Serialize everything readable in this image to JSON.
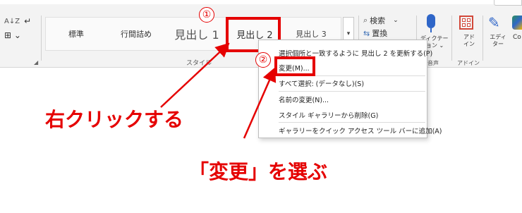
{
  "ribbon": {
    "paragraph_tools": {
      "sort_label": "A↓Z",
      "return_label": "↵",
      "border_label": "⊞ ⌄"
    },
    "styles_group_label": "スタイル",
    "voice_group_label": "音声",
    "addins_group_label": "アドイン"
  },
  "style_gallery": {
    "items": [
      "標準",
      "行間詰め",
      "見出し 1",
      "見出し 2",
      "見出し 3"
    ],
    "scroll_more": "▾"
  },
  "editing": {
    "search_label": "検索",
    "search_chevron": "⌄",
    "replace_label": "置換",
    "select_label": "⌄"
  },
  "voice": {
    "dictate_label": "ディクテー",
    "dictate_label2": "ション ⌄"
  },
  "addins": {
    "label": "アド",
    "label2": "イン"
  },
  "editor": {
    "label": "エディ",
    "label2": "ター"
  },
  "copilot": {
    "label": "Co"
  },
  "context_menu": {
    "items": [
      "選択個所と一致するように 見出し 2 を更新する(P)",
      "変更(M)...",
      "すべて選択: (データなし)(S)",
      "名前の変更(N)...",
      "スタイル ギャラリーから削除(G)",
      "ギャラリーをクイック アクセス ツール バーに追加(A)"
    ]
  },
  "annotations": {
    "step1": "①",
    "step2": "②",
    "right_click_text": "右クリックする",
    "choose_change_text": "「変更」を選ぶ",
    "accent_color": "#e50000"
  }
}
